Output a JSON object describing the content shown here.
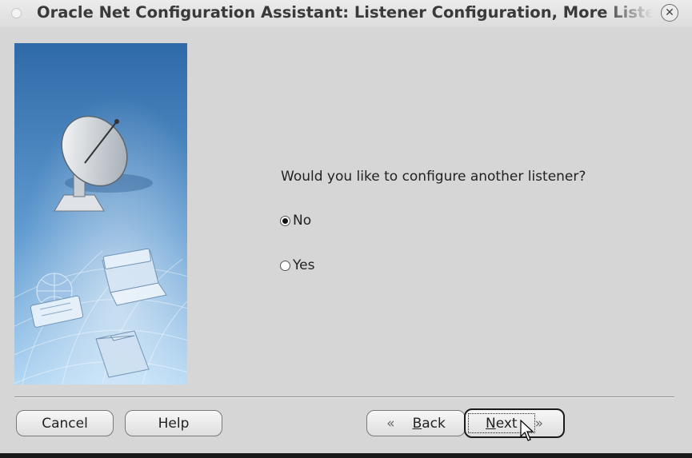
{
  "window": {
    "title": "Oracle Net Configuration Assistant: Listener Configuration, More Listeners",
    "close_glyph": "✕"
  },
  "main": {
    "question": "Would you like to configure another listener?",
    "options": [
      {
        "label": "No",
        "checked": true
      },
      {
        "label": "Yes",
        "checked": false
      }
    ]
  },
  "buttons": {
    "cancel": "Cancel",
    "help": "Help",
    "back_mnemonic": "B",
    "back_rest": "ack",
    "back_icon": "«",
    "next_mnemonic": "N",
    "next_rest": "ext",
    "next_icon": "»"
  },
  "colors": {
    "window_bg": "#d6d6d6",
    "side_panel_top": "#2f6aa8",
    "side_panel_bottom": "#b4d8f4"
  },
  "icons": {
    "side_panel": [
      "satellite-dish-icon",
      "globe-icon",
      "id-card-icon",
      "laptop-icon",
      "folder-icon"
    ]
  }
}
